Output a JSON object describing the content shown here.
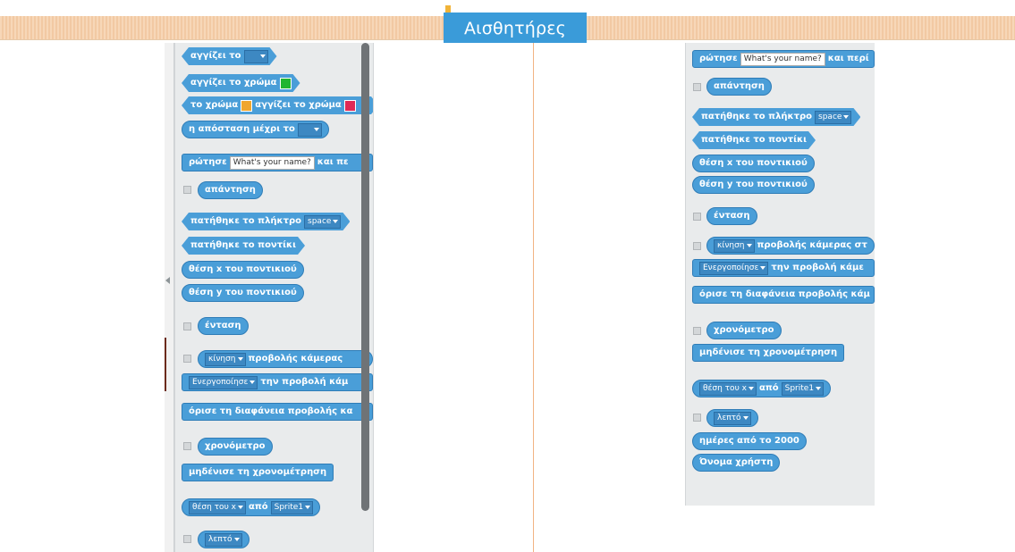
{
  "category_tab": {
    "label": "Αισθητήρες"
  },
  "colors": {
    "tab": "#3a9bd9",
    "block": "#4a9ed8",
    "band": "#f2c9a3",
    "swatch_green": "#22b531",
    "swatch_orange": "#f0a62e",
    "swatch_red": "#e02a55"
  },
  "left": {
    "touching_label": "αγγίζει το",
    "touching_color_label": "αγγίζει το χρώμα",
    "color_touching": {
      "part1": "το χρώμα",
      "part2": "αγγίζει το χρώμα"
    },
    "distance_label": "η απόσταση μέχρι το",
    "ask": {
      "label": "ρώτησε",
      "default": "What's your name?",
      "tail": "και πε"
    },
    "answer_label": "απάντηση",
    "key_pressed": {
      "label": "πατήθηκε το πλήκτρο",
      "key": "space"
    },
    "mouse_down_label": "πατήθηκε το ποντίκι",
    "mouse_x_label": "θέση x του ποντικιού",
    "mouse_y_label": "θέση y του ποντικιού",
    "loudness_label": "ένταση",
    "video_motion": {
      "option": "κίνηση",
      "label": "προβολής κάμερας"
    },
    "turn_video": {
      "option": "Ενεργοποίησε",
      "label": "την προβολή κάμ"
    },
    "transparency_label": "όρισε τη διαφάνεια προβολής κα",
    "timer_label": "χρονόμετρο",
    "reset_timer_label": "μηδένισε τη χρονομέτρηση",
    "attribute_of": {
      "option": "θέση του x",
      "of": "από",
      "sprite": "Sprite1"
    },
    "current_option": "λεπτό"
  },
  "right": {
    "ask": {
      "label": "ρώτησε",
      "default": "What's your name?",
      "tail": "και περί"
    },
    "answer_label": "απάντηση",
    "key_pressed": {
      "label": "πατήθηκε το πλήκτρο",
      "key": "space"
    },
    "mouse_down_label": "πατήθηκε το ποντίκι",
    "mouse_x_label": "θέση x του ποντικιού",
    "mouse_y_label": "θέση y του ποντικιού",
    "loudness_label": "ένταση",
    "video_motion": {
      "option": "κίνηση",
      "label": "προβολής κάμερας στ"
    },
    "turn_video": {
      "option": "Ενεργοποίησε",
      "label": "την προβολή κάμε"
    },
    "transparency_label": "όρισε τη διαφάνεια προβολής κάμ",
    "timer_label": "χρονόμετρο",
    "reset_timer_label": "μηδένισε τη χρονομέτρηση",
    "attribute_of": {
      "option": "θέση του x",
      "of": "από",
      "sprite": "Sprite1"
    },
    "current_option": "λεπτό",
    "days_since_label": "ημέρες από το 2000",
    "username_label": "Όνομα χρήστη"
  }
}
